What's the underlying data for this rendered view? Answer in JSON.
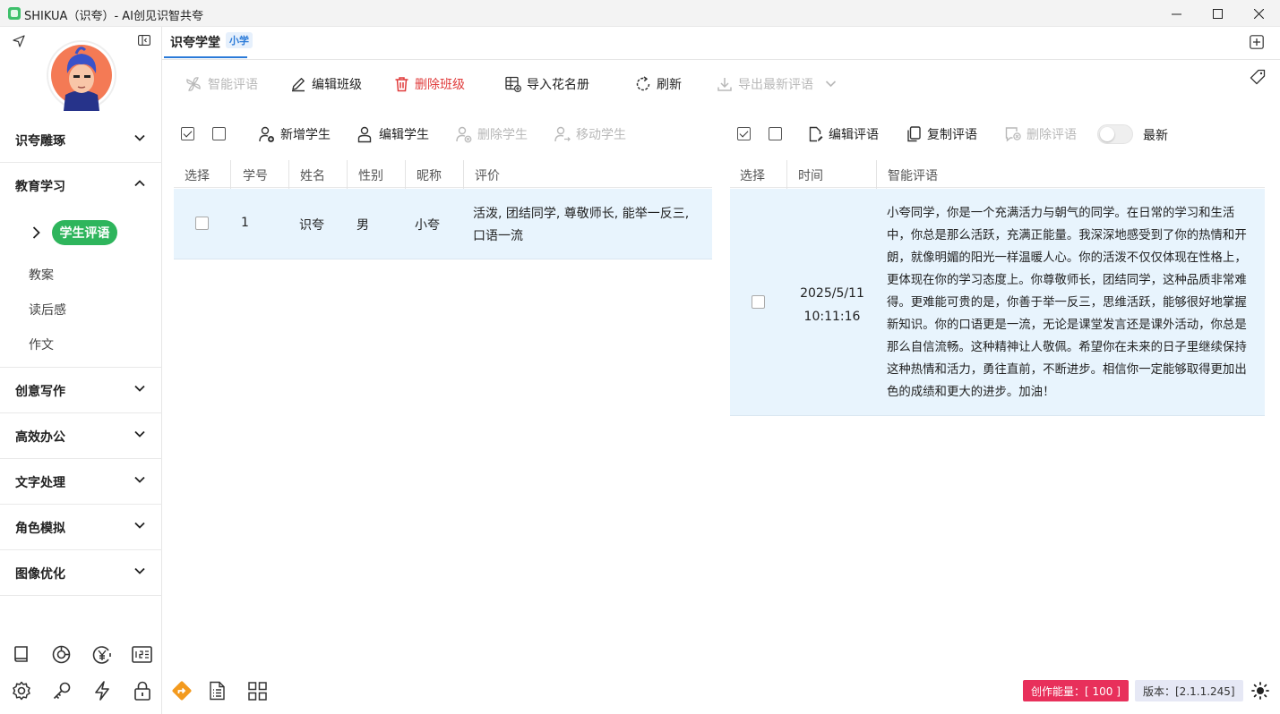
{
  "window": {
    "title": "SHIKUA（识夸）- AI创见识智共夸"
  },
  "sidebar": {
    "categories": [
      {
        "label": "识夸雕琢"
      },
      {
        "label": "教育学习"
      },
      {
        "label": "创意写作"
      },
      {
        "label": "高效办公"
      },
      {
        "label": "文字处理"
      },
      {
        "label": "角色模拟"
      },
      {
        "label": "图像优化"
      }
    ],
    "education_items": [
      {
        "label": "学生评语"
      },
      {
        "label": "教案"
      },
      {
        "label": "读后感"
      },
      {
        "label": "作文"
      }
    ]
  },
  "tab": {
    "title": "识夸学堂",
    "badge": "小学"
  },
  "toolbar": {
    "smart_comment": "智能评语",
    "edit_class": "编辑班级",
    "delete_class": "删除班级",
    "import_roster": "导入花名册",
    "refresh": "刷新",
    "export_latest": "导出最新评语"
  },
  "students_toolbar": {
    "add": "新增学生",
    "edit": "编辑学生",
    "delete": "删除学生",
    "move": "移动学生"
  },
  "comments_toolbar": {
    "edit": "编辑评语",
    "copy": "复制评语",
    "delete": "删除评语",
    "latest_label": "最新"
  },
  "students_table": {
    "headers": [
      "选择",
      "学号",
      "姓名",
      "性别",
      "昵称",
      "评价"
    ],
    "rows": [
      {
        "id": "1",
        "name": "识夸",
        "gender": "男",
        "nickname": "小夸",
        "evaluation": "活泼, 团结同学, 尊敬师长, 能举一反三, 口语一流"
      }
    ]
  },
  "comments_table": {
    "headers": [
      "选择",
      "时间",
      "智能评语"
    ],
    "rows": [
      {
        "date": "2025/5/11",
        "time": "10:11:16",
        "comment": "小夸同学，你是一个充满活力与朝气的同学。在日常的学习和生活中，你总是那么活跃，充满正能量。我深深地感受到了你的热情和开朗，就像明媚的阳光一样温暖人心。你的活泼不仅仅体现在性格上，更体现在你的学习态度上。你尊敬师长，团结同学，这种品质非常难得。更难能可贵的是，你善于举一反三，思维活跃，能够很好地掌握新知识。你的口语更是一流，无论是课堂发言还是课外活动，你总是那么自信流畅。这种精神让人敬佩。希望你在未来的日子里继续保持这种热情和活力，勇往直前，不断进步。相信你一定能够取得更加出色的成绩和更大的进步。加油！"
      }
    ]
  },
  "status": {
    "energy": "创作能量：[ 100 ]",
    "version": "版本：[2.1.1.245]"
  },
  "colors": {
    "accent_green": "#2eb55c",
    "accent_blue": "#2a7ad8",
    "danger": "#e03c3c",
    "energy_bg": "#e8305b",
    "row_highlight": "#e8f4fd"
  }
}
